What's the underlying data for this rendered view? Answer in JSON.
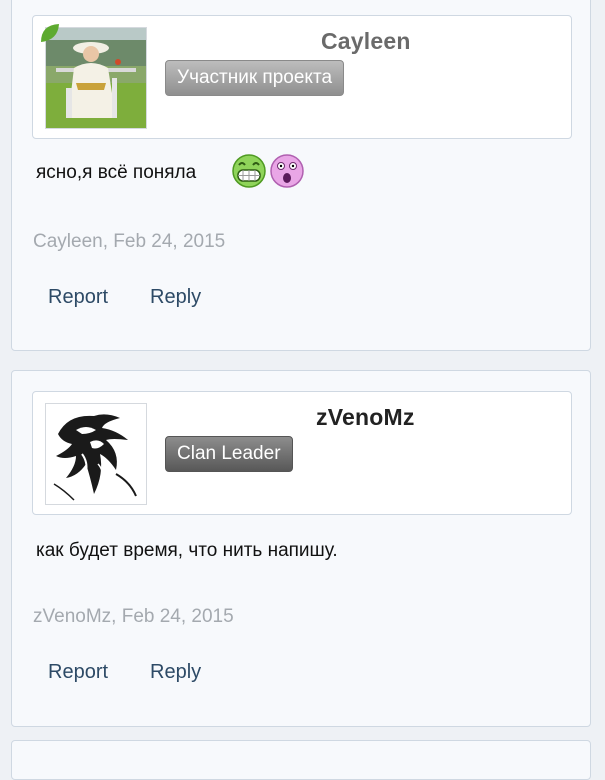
{
  "posts": [
    {
      "author": "Cayleen",
      "badge": "Участник проекта",
      "message": "ясно,я всё поняла",
      "smilies": [
        "grin-smiley-icon",
        "shocked-smiley-icon"
      ],
      "meta": "Cayleen, Feb 24, 2015",
      "report_label": "Report",
      "reply_label": "Reply"
    },
    {
      "author": "zVenoMz",
      "badge": "Clan Leader",
      "message": "как будет время, что нить напишу.",
      "meta": "zVenoMz, Feb 24, 2015",
      "report_label": "Report",
      "reply_label": "Reply"
    }
  ],
  "colors": {
    "link": "#2d4a66",
    "meta": "#a4a9af",
    "panel_border": "#cfd8e2"
  }
}
